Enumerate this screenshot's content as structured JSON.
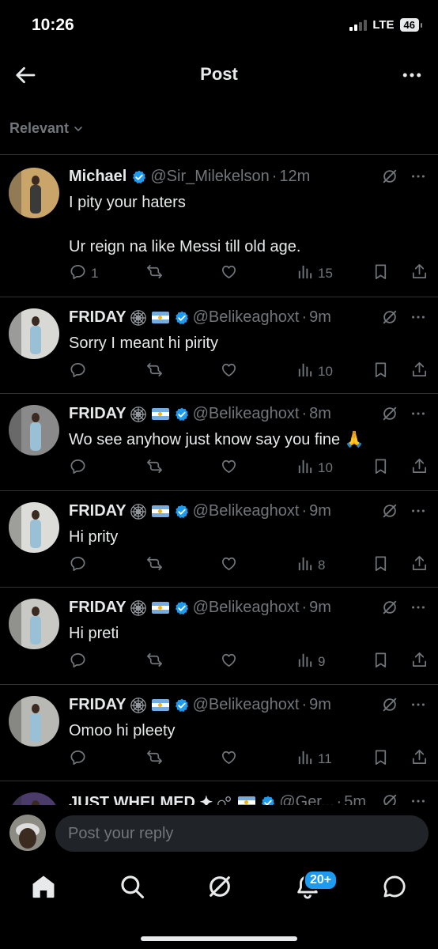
{
  "status_bar": {
    "time": "10:26",
    "network": "LTE",
    "battery": "46"
  },
  "header": {
    "title": "Post",
    "back_icon": "arrow-left-icon",
    "more_icon": "more-horizontal-icon"
  },
  "filter": {
    "label": "Relevant"
  },
  "replies": [
    {
      "name": "Michael",
      "badges": [],
      "handle": "@Sir_Milekelson",
      "time": "12m",
      "text": "I pity your haters\n\nUr reign na like Messi till old age.",
      "reply_count": "1",
      "retweet_count": "",
      "like_count": "",
      "views": "15"
    },
    {
      "name": "FRIDAY",
      "badges": [
        "web-icon",
        "argentina-flag"
      ],
      "handle": "@Belikeaghoxt",
      "time": "9m",
      "text": "Sorry I meant hi pirity",
      "reply_count": "",
      "retweet_count": "",
      "like_count": "",
      "views": "10"
    },
    {
      "name": "FRIDAY",
      "badges": [
        "web-icon",
        "argentina-flag"
      ],
      "handle": "@Belikeaghoxt",
      "time": "8m",
      "text": "Wo see anyhow just know say you fine 🙏",
      "reply_count": "",
      "retweet_count": "",
      "like_count": "",
      "views": "10"
    },
    {
      "name": "FRIDAY",
      "badges": [
        "web-icon",
        "argentina-flag"
      ],
      "handle": "@Belikeaghoxt",
      "time": "9m",
      "text": "Hi prity",
      "reply_count": "",
      "retweet_count": "",
      "like_count": "",
      "views": "8"
    },
    {
      "name": "FRIDAY",
      "badges": [
        "web-icon",
        "argentina-flag"
      ],
      "handle": "@Belikeaghoxt",
      "time": "9m",
      "text": "Hi preti",
      "reply_count": "",
      "retweet_count": "",
      "like_count": "",
      "views": "9"
    },
    {
      "name": "FRIDAY",
      "badges": [
        "web-icon",
        "argentina-flag"
      ],
      "handle": "@Belikeaghoxt",
      "time": "9m",
      "text": "Omoo hi pleety",
      "reply_count": "",
      "retweet_count": "",
      "like_count": "",
      "views": "11"
    },
    {
      "name": "JUST WHELMED ✦",
      "badges": [
        "bubbles-icon",
        "argentina-flag"
      ],
      "handle": "@Ger...",
      "time": "5m",
      "text": "",
      "reply_count": "",
      "retweet_count": "",
      "like_count": "",
      "views": ""
    }
  ],
  "reply_bar": {
    "placeholder": "Post your reply"
  },
  "tab_bar": {
    "items": [
      "home-icon",
      "search-icon",
      "grok-icon",
      "notifications-icon",
      "messages-icon"
    ],
    "notifications_badge": "20+"
  },
  "colors": {
    "background": "#000000",
    "text": "#e7e9ea",
    "muted": "#71767b",
    "accent": "#1d9bf0",
    "divider": "#2f3336"
  }
}
